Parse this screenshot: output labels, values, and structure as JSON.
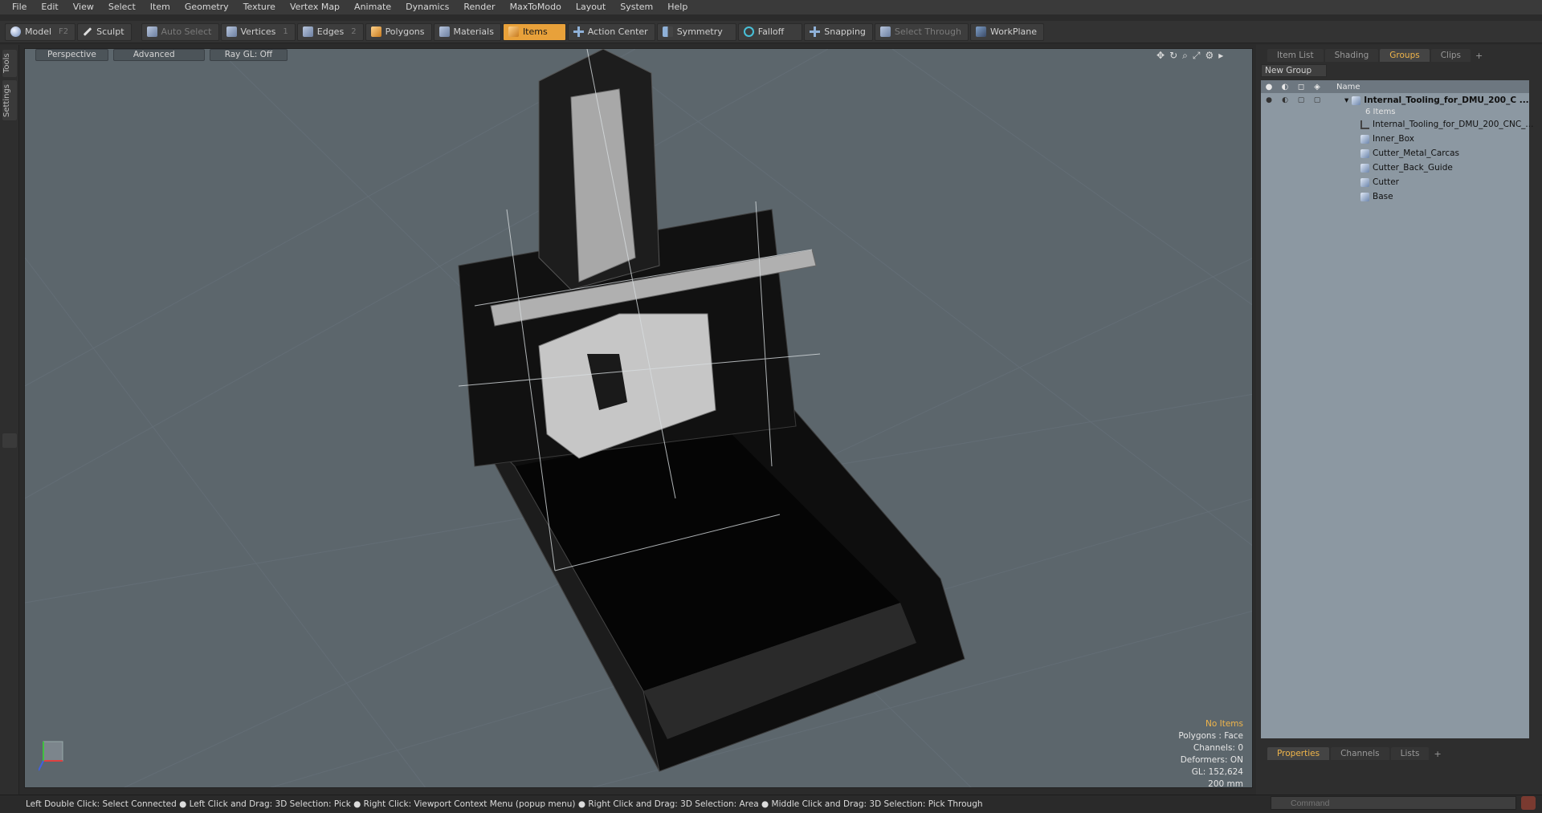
{
  "menubar": [
    "File",
    "Edit",
    "View",
    "Select",
    "Item",
    "Geometry",
    "Texture",
    "Vertex Map",
    "Animate",
    "Dynamics",
    "Render",
    "MaxToModo",
    "Layout",
    "System",
    "Help"
  ],
  "toolbar": {
    "model": {
      "label": "Model",
      "key": "F2"
    },
    "sculpt": {
      "label": "Sculpt"
    },
    "auto_select": {
      "label": "Auto Select"
    },
    "vertices": {
      "label": "Vertices",
      "key": "1"
    },
    "edges": {
      "label": "Edges",
      "key": "2"
    },
    "polygons": {
      "label": "Polygons"
    },
    "materials": {
      "label": "Materials"
    },
    "items": {
      "label": "Items"
    },
    "action_center": {
      "label": "Action Center"
    },
    "symmetry": {
      "label": "Symmetry"
    },
    "falloff": {
      "label": "Falloff"
    },
    "snapping": {
      "label": "Snapping"
    },
    "select_through": {
      "label": "Select Through"
    },
    "workplane": {
      "label": "WorkPlane"
    }
  },
  "left_tabs": [
    "Tools",
    "Settings"
  ],
  "viewport": {
    "view": "Perspective",
    "shading": "Advanced",
    "raygl": "Ray GL: Off",
    "info": {
      "selection": "No Items",
      "polygons": "Polygons : Face",
      "channels": "Channels: 0",
      "deformers": "Deformers: ON",
      "gl": "GL: 152,624",
      "scale": "200 mm"
    }
  },
  "right_panel": {
    "tabs": [
      "Item List",
      "Shading",
      "Groups",
      "Clips"
    ],
    "active_tab": "Groups",
    "new_group": "New Group",
    "column_name": "Name",
    "group": {
      "name": "Internal_Tooling_for_DMU_200_C ...",
      "count": "6 Items"
    },
    "items": [
      "Internal_Tooling_for_DMU_200_CNC_...",
      "Inner_Box",
      "Cutter_Metal_Carcas",
      "Cutter_Back_Guide",
      "Cutter",
      "Base"
    ]
  },
  "bottom_panel": {
    "tabs": [
      "Properties",
      "Channels",
      "Lists"
    ],
    "active_tab": "Properties"
  },
  "statusbar": "Left Double Click: Select Connected ● Left Click and Drag: 3D Selection: Pick ● Right Click: Viewport Context Menu (popup menu) ● Right Click and Drag: 3D Selection: Area ● Middle Click and Drag: 3D Selection: Pick Through",
  "command": {
    "placeholder": "Command"
  },
  "colors": {
    "accent": "#e8a13a",
    "viewport_bg": "#5c666c",
    "tree_bg": "#8c98a2"
  }
}
